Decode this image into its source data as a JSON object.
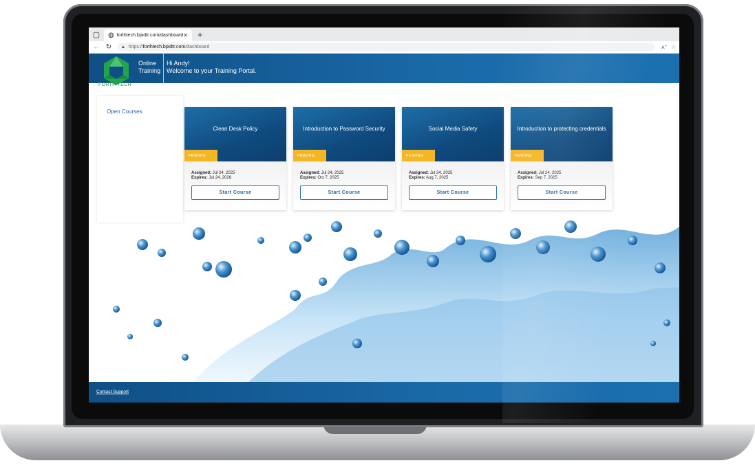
{
  "browser": {
    "tab_title": "forthtech.bpidtr.com/dashboard",
    "url_prefix": "https://",
    "url_host": "forthtech.bpidtr.com",
    "url_path": "/dashboard"
  },
  "header": {
    "brand_line1": "Online",
    "brand_line2": "Training",
    "logo_text": "FORTH TECH",
    "greeting_line1": "Hi Andy!",
    "greeting_line2": "Welcome to your Training Portal."
  },
  "sidebar": {
    "items": [
      {
        "label": "Open Courses"
      }
    ]
  },
  "courses": [
    {
      "title": "Clean Desk Policy",
      "status": "PENDING",
      "assigned_label": "Assigned:",
      "assigned": "Jul 24, 2025",
      "expires_label": "Expires:",
      "expires": "Jul 24, 2026",
      "button": "Start Course"
    },
    {
      "title": "Introduction to Password Security",
      "status": "PENDING",
      "assigned_label": "Assigned:",
      "assigned": "Jul 24, 2025",
      "expires_label": "Expires:",
      "expires": "Oct 7, 2025",
      "button": "Start Course"
    },
    {
      "title": "Social Media Safety",
      "status": "PENDING",
      "assigned_label": "Assigned:",
      "assigned": "Jul 24, 2025",
      "expires_label": "Expires:",
      "expires": "Aug 7, 2025",
      "button": "Start Course"
    },
    {
      "title": "Introduction to protecting credentials",
      "status": "PENDING",
      "assigned_label": "Assigned:",
      "assigned": "Jul 24, 2025",
      "expires_label": "Expires:",
      "expires": "Sep 7, 2025",
      "button": "Start Course"
    }
  ],
  "footer": {
    "contact_label": "Contact Support"
  },
  "colors": {
    "header_blue": "#1a6aa8",
    "pending": "#f5b623",
    "link_blue": "#1a64b0"
  }
}
